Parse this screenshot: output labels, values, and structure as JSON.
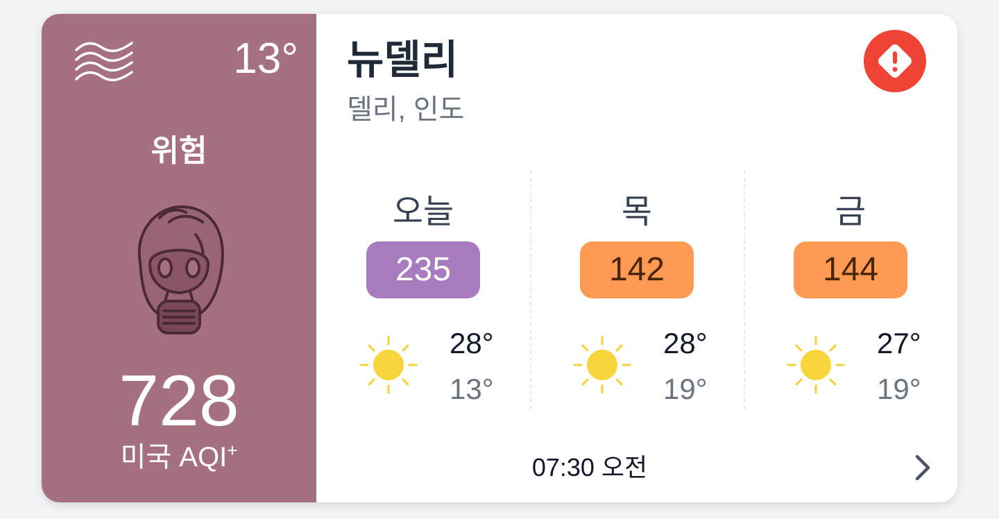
{
  "current": {
    "temperature": "13°",
    "level": "위험",
    "aqi_value": "728",
    "aqi_label": "미국 AQI",
    "aqi_label_sup": "+",
    "level_color": "#a5717e",
    "icons": [
      "wind-icon",
      "gas-mask-icon"
    ]
  },
  "location": {
    "city": "뉴델리",
    "region": "델리, 인도",
    "alert_icon": "alert-diamond-icon",
    "alert_color": "#ef4335"
  },
  "forecast": [
    {
      "day": "오늘",
      "aqi": "235",
      "aqi_bg": "#a87bbf",
      "aqi_fg": "#ffffff",
      "icon": "sun-icon",
      "high": "28°",
      "low": "13°"
    },
    {
      "day": "목",
      "aqi": "142",
      "aqi_bg": "#ff9a54",
      "aqi_fg": "#4a2407",
      "icon": "sun-icon",
      "high": "28°",
      "low": "19°"
    },
    {
      "day": "금",
      "aqi": "144",
      "aqi_bg": "#ff9a54",
      "aqi_fg": "#4a2407",
      "icon": "sun-icon",
      "high": "27°",
      "low": "19°"
    }
  ],
  "footer": {
    "updated_time": "07:30 오전",
    "chevron_icon": "chevron-right-icon"
  }
}
